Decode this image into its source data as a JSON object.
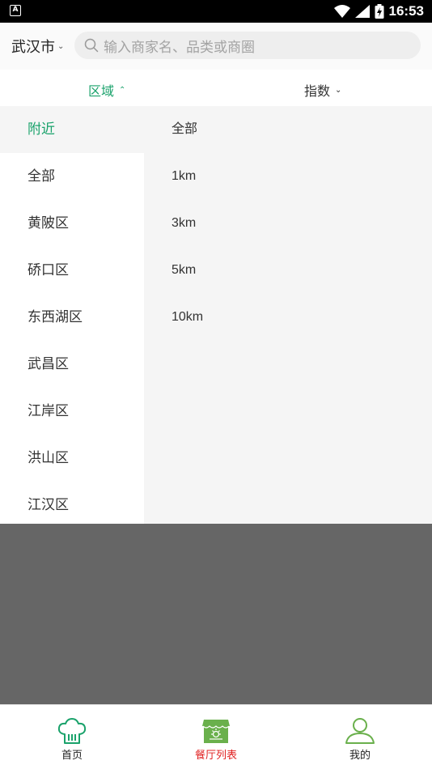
{
  "status_bar": {
    "time": "16:53",
    "left_icon": "A"
  },
  "header": {
    "city": "武汉市",
    "search_placeholder": "输入商家名、品类或商圈"
  },
  "filters": {
    "region_label": "区域",
    "index_label": "指数",
    "region_expanded": true
  },
  "regions": [
    {
      "label": "附近",
      "active": true
    },
    {
      "label": "全部",
      "active": false
    },
    {
      "label": "黄陂区",
      "active": false
    },
    {
      "label": "硚口区",
      "active": false
    },
    {
      "label": "东西湖区",
      "active": false
    },
    {
      "label": "武昌区",
      "active": false
    },
    {
      "label": "江岸区",
      "active": false
    },
    {
      "label": "洪山区",
      "active": false
    },
    {
      "label": "江汉区",
      "active": false
    }
  ],
  "distances": [
    "全部",
    "1km",
    "3km",
    "5km",
    "10km"
  ],
  "bottom_nav": [
    {
      "label": "首页",
      "icon": "chef-hat-icon",
      "active": false
    },
    {
      "label": "餐厅列表",
      "icon": "restaurant-store-icon",
      "active": true
    },
    {
      "label": "我的",
      "icon": "user-profile-icon",
      "active": false
    }
  ],
  "colors": {
    "accent_green": "#1aa26b",
    "active_nav_red": "#e02020"
  }
}
